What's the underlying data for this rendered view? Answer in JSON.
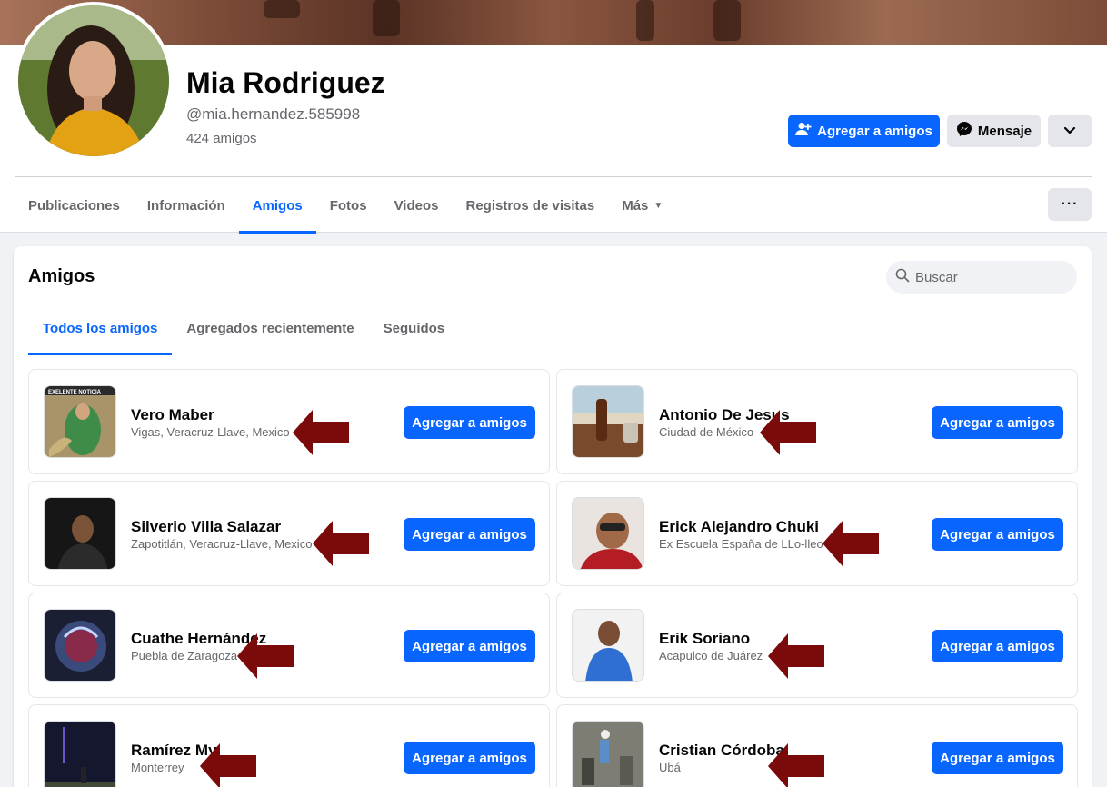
{
  "profile": {
    "name": "Mia Rodriguez",
    "handle": "@mia.hernandez.585998",
    "friends_count": "424 amigos",
    "actions": {
      "add_friend": "Agregar a amigos",
      "message": "Mensaje"
    }
  },
  "nav": {
    "tabs": [
      {
        "label": "Publicaciones"
      },
      {
        "label": "Información"
      },
      {
        "label": "Amigos"
      },
      {
        "label": "Fotos"
      },
      {
        "label": "Videos"
      },
      {
        "label": "Registros de visitas"
      },
      {
        "label": "Más"
      }
    ],
    "active_tab": "Amigos"
  },
  "friends_panel": {
    "title": "Amigos",
    "search_placeholder": "Buscar",
    "subtabs": [
      {
        "label": "Todos los amigos"
      },
      {
        "label": "Agregados recientemente"
      },
      {
        "label": "Seguidos"
      }
    ],
    "active_subtab": "Todos los amigos",
    "friends": [
      {
        "name": "Vero Maber",
        "subtitle": "Vigas, Veracruz-Llave, Mexico",
        "button": "Agregar a amigos",
        "thumb_text": "EXELENTE NOTICIA"
      },
      {
        "name": "Antonio De Jesus",
        "subtitle": "Ciudad de México",
        "button": "Agregar a amigos"
      },
      {
        "name": "Silverio Villa Salazar",
        "subtitle": "Zapotitlán, Veracruz-Llave, Mexico",
        "button": "Agregar a amigos"
      },
      {
        "name": "Erick Alejandro Chuki",
        "subtitle": "Ex Escuela España de LLo-lleo",
        "button": "Agregar a amigos"
      },
      {
        "name": "Cuathe Hernández",
        "subtitle": "Puebla de Zaragoza",
        "button": "Agregar a amigos"
      },
      {
        "name": "Erik Soriano",
        "subtitle": "Acapulco de Juárez",
        "button": "Agregar a amigos"
      },
      {
        "name": "Ramírez My",
        "subtitle": "Monterrey",
        "button": "Agregar a amigos"
      },
      {
        "name": "Cristian Córdoba",
        "subtitle": "Ubá",
        "button": "Agregar a amigos"
      }
    ]
  },
  "colors": {
    "accent": "#0866ff",
    "annotation_arrow": "#7b0a0a",
    "page_bg": "#f0f2f5"
  },
  "icons": {
    "add_friend": "user-plus-icon",
    "message": "messenger-icon",
    "dropdown": "chevron-down-icon",
    "more": "ellipsis-icon",
    "search": "search-icon"
  }
}
